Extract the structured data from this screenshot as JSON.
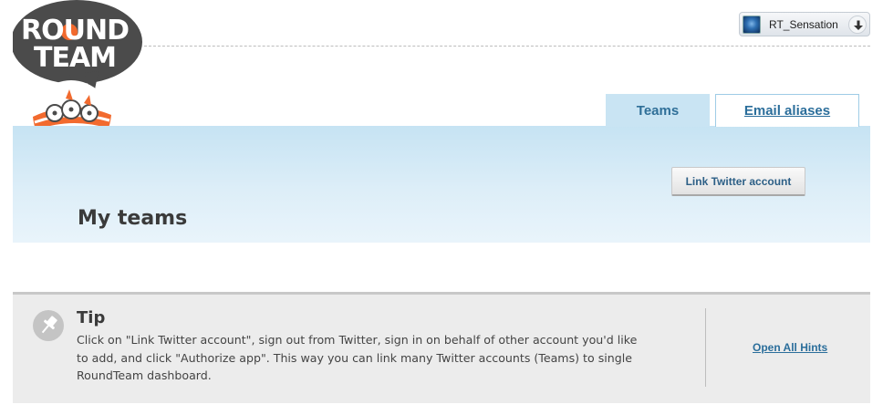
{
  "logo": {
    "line1": "ROUND",
    "line2": "TEAM",
    "colors": {
      "bubble": "#4b4b4b",
      "orange": "#f26a2e",
      "white": "#ffffff"
    }
  },
  "user_menu": {
    "username": "RT_Sensation",
    "avatar_icon": "avatar-image",
    "dropdown_icon": "arrow-down-icon"
  },
  "tabs": [
    {
      "label": "Teams",
      "active": true
    },
    {
      "label": "Email aliases",
      "active": false
    }
  ],
  "banner": {
    "link_button_label": "Link Twitter account",
    "page_title": "My teams"
  },
  "tip": {
    "icon": "pushpin-icon",
    "title": "Tip",
    "body": "Click on \"Link Twitter account\", sign out from Twitter, sign in on behalf of other account you'd like to add, and click \"Authorize app\". This way you can link many Twitter accounts (Teams) to single RoundTeam dashboard.",
    "open_all_hints": "Open All Hints"
  },
  "colors": {
    "banner_bg": "#cfe7f5",
    "tab_active_bg": "#c9e4f3",
    "link_color": "#2b6e9b",
    "tip_bg": "#ececec"
  }
}
